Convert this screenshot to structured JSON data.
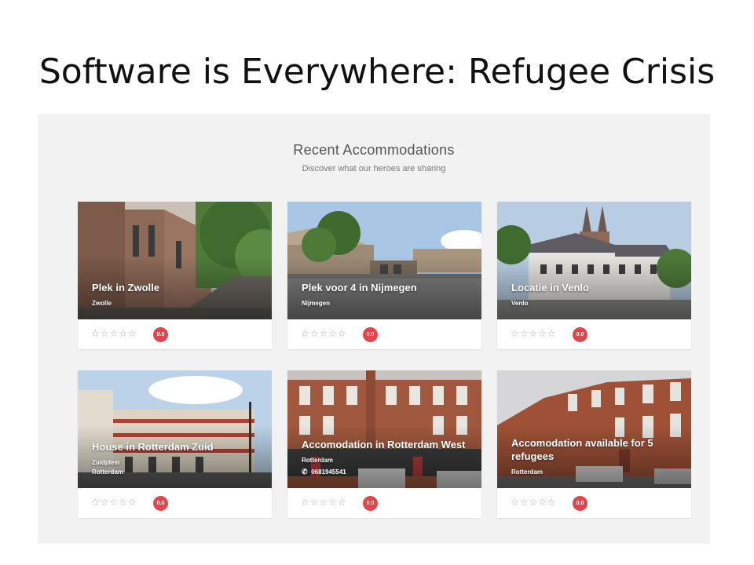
{
  "slide": {
    "title": "Software is Everywhere: Refugee Crisis"
  },
  "section": {
    "title": "Recent Accommodations",
    "subtitle": "Discover what our heroes are sharing"
  },
  "icons": {
    "star": "star-outline-icon",
    "phone": "phone-icon"
  },
  "colors": {
    "badge": "#e0474c",
    "panel": "#f2f2f2",
    "star": "#aaaaaa"
  },
  "rating_stars": "☆☆☆☆☆",
  "cards": [
    {
      "name": "Plek in Zwolle",
      "city": "Zwolle",
      "rating": "0.0"
    },
    {
      "name": "Plek voor 4 in Nijmegen",
      "city": "Nijmegen",
      "rating": "0.0"
    },
    {
      "name": "Locatie in Venlo",
      "city": "Venlo",
      "rating": "0.0"
    },
    {
      "name": "House in Rotterdam Zuid",
      "sub": "Zuidplein",
      "city": "Rotterdam",
      "rating": "0.0"
    },
    {
      "name": "Accomodation in Rotterdam West",
      "city": "Rotterdam",
      "phone": "0681945541",
      "rating": "0.0"
    },
    {
      "name": "Accomodation available for 5 refugees",
      "city": "Rotterdam",
      "rating": "0.0"
    }
  ]
}
